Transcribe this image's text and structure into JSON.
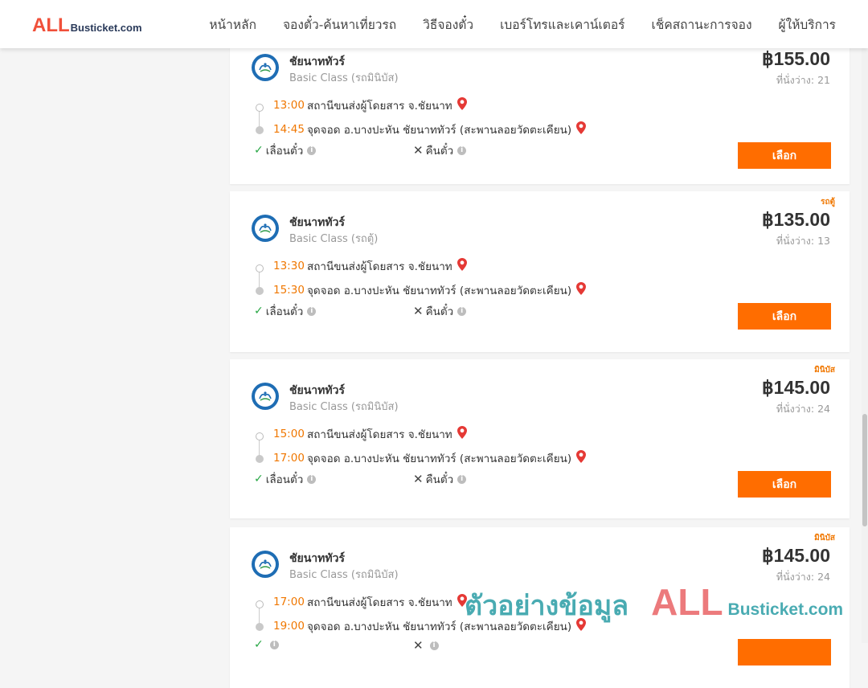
{
  "header": {
    "logo_all": "ALL",
    "logo_rest": "Busticket.com",
    "nav": [
      "หน้าหลัก",
      "จองตั๋ว-ค้นหาเที่ยวรถ",
      "วิธีจองตั๋ว",
      "เบอร์โทรและเคาน์เตอร์",
      "เช็คสถานะการจอง",
      "ผู้ให้บริการ"
    ]
  },
  "trips": [
    {
      "badge": "",
      "operator": "ชัยนาททัวร์",
      "class": "Basic Class (รถมินิบัส)",
      "price": "฿155.00",
      "seats": "ที่นั่งว่าง: 21",
      "depart_time": "13:00",
      "depart_place": "สถานีขนส่งผู้โดยสาร จ.ชัยนาท",
      "arrive_time": "14:45",
      "arrive_place": "จุดจอด อ.บางปะหัน ชัยนาททัวร์ (สะพานลอยวัดตะเคียน)",
      "option_change": "เลื่อนตั๋ว",
      "option_refund": "คืนตั๋ว",
      "select_label": "เลือก"
    },
    {
      "badge": "รถตู้",
      "operator": "ชัยนาททัวร์",
      "class": "Basic Class (รถตู้)",
      "price": "฿135.00",
      "seats": "ที่นั่งว่าง: 13",
      "depart_time": "13:30",
      "depart_place": "สถานีขนส่งผู้โดยสาร จ.ชัยนาท",
      "arrive_time": "15:30",
      "arrive_place": "จุดจอด อ.บางปะหัน ชัยนาททัวร์ (สะพานลอยวัดตะเคียน)",
      "option_change": "เลื่อนตั๋ว",
      "option_refund": "คืนตั๋ว",
      "select_label": "เลือก"
    },
    {
      "badge": "มินิบัส",
      "operator": "ชัยนาททัวร์",
      "class": "Basic Class (รถมินิบัส)",
      "price": "฿145.00",
      "seats": "ที่นั่งว่าง: 24",
      "depart_time": "15:00",
      "depart_place": "สถานีขนส่งผู้โดยสาร จ.ชัยนาท",
      "arrive_time": "17:00",
      "arrive_place": "จุดจอด อ.บางปะหัน ชัยนาททัวร์ (สะพานลอยวัดตะเคียน)",
      "option_change": "เลื่อนตั๋ว",
      "option_refund": "คืนตั๋ว",
      "select_label": "เลือก"
    },
    {
      "badge": "มินิบัส",
      "operator": "ชัยนาททัวร์",
      "class": "Basic Class (รถมินิบัส)",
      "price": "฿145.00",
      "seats": "ที่นั่งว่าง: 24",
      "depart_time": "17:00",
      "depart_place": "สถานีขนส่งผู้โดยสาร จ.ชัยนาท",
      "arrive_time": "19:00",
      "arrive_place": "จุดจอด อ.บางปะหัน ชัยนาททัวร์ (สะพานลอยวัดตะเคียน)",
      "option_change": "",
      "option_refund": "",
      "select_label": ""
    }
  ],
  "watermark": {
    "text": "ตัวอย่างข้อมูล",
    "all": "ALL",
    "rest": "Busticket.com"
  },
  "colors": {
    "accent": "#ff6d00",
    "time": "#f07700",
    "pin": "#e53935",
    "check": "#28a745",
    "logo_red": "#f0503a"
  }
}
